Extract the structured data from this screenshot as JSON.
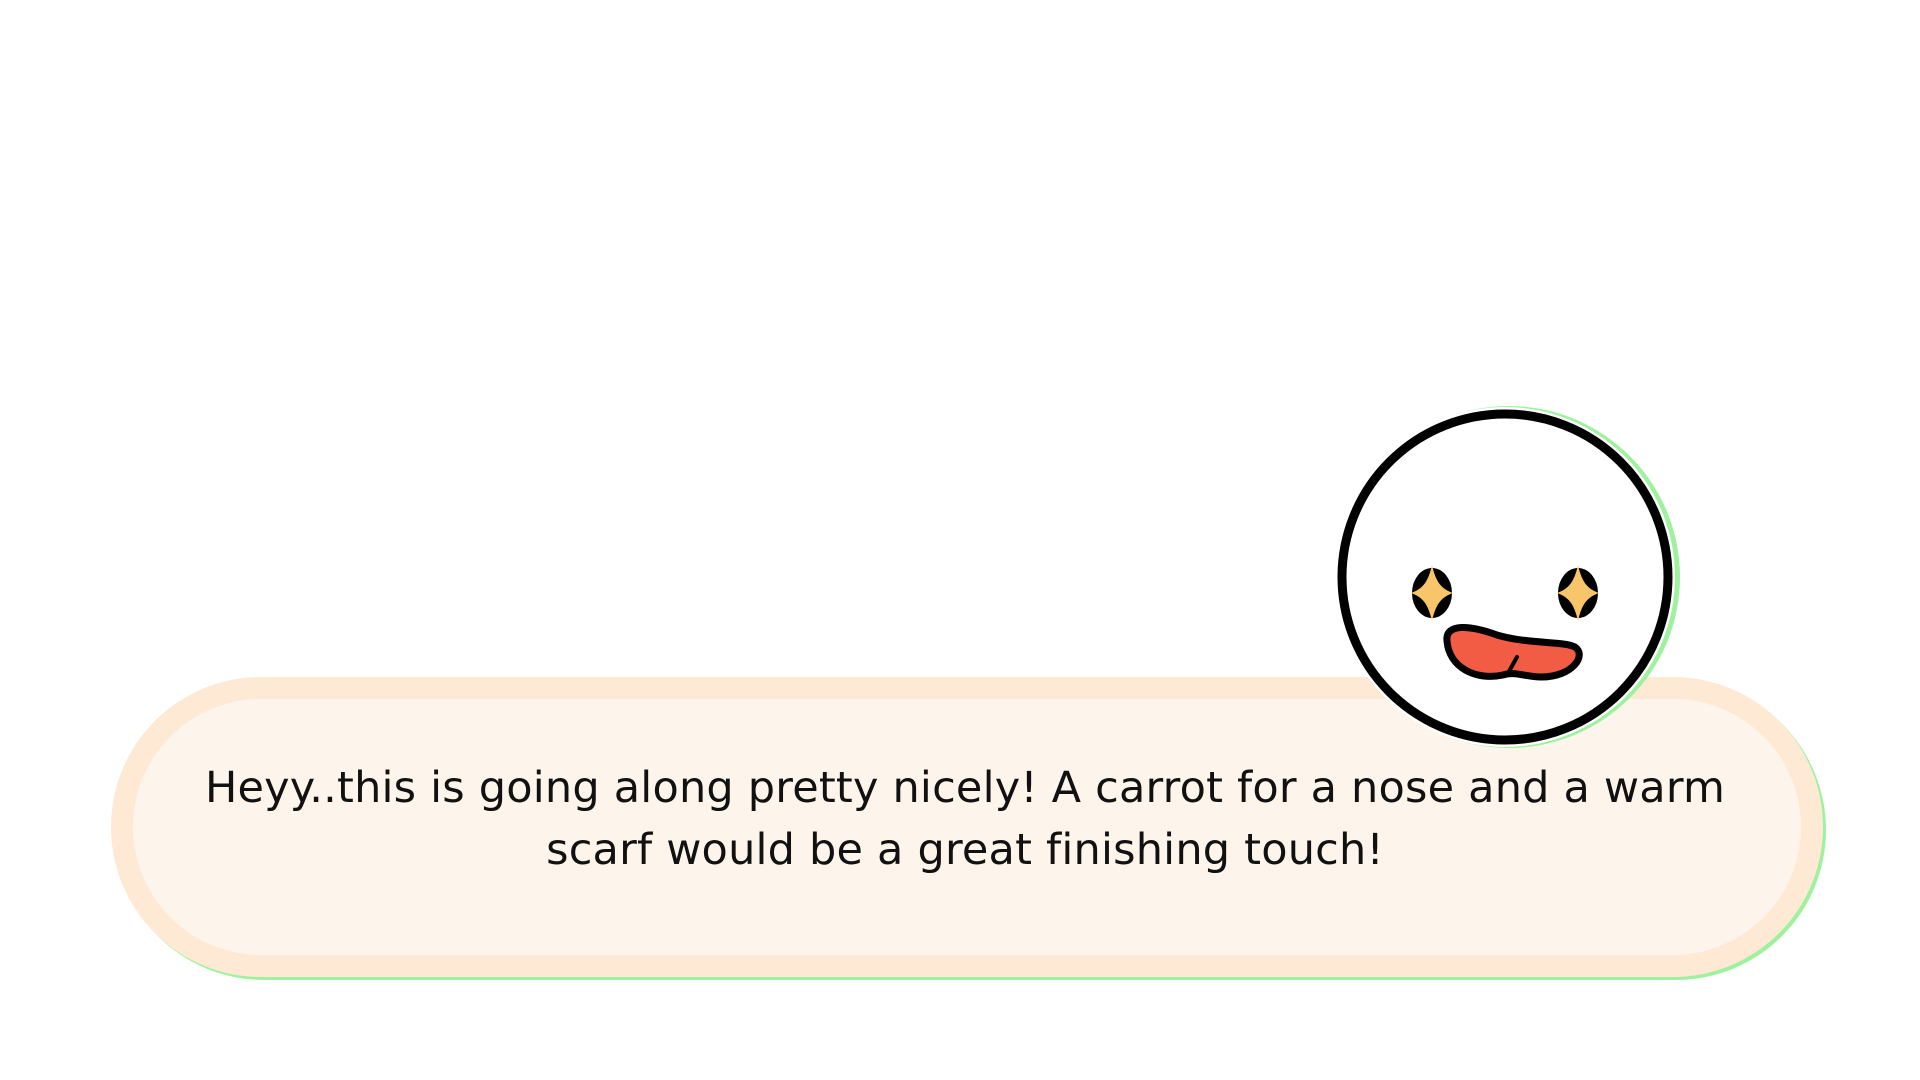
{
  "dialog": {
    "text": "Heyy..this is going along pretty nicely! A carrot for a nose and a warm scarf would be a great finishing touch!"
  },
  "avatar": {
    "icon": "snowman-face-icon",
    "expression": "starry-eyed-open-mouth"
  },
  "colors": {
    "background": "#ffffff",
    "bubble_fill": "#fdf5eb",
    "bubble_border": "#fde9d4",
    "bubble_shadow": "#9ef29e",
    "text": "#111111",
    "avatar_outline": "#000000",
    "eye_star": "#f8c56a",
    "mouth": "#f25c45"
  }
}
